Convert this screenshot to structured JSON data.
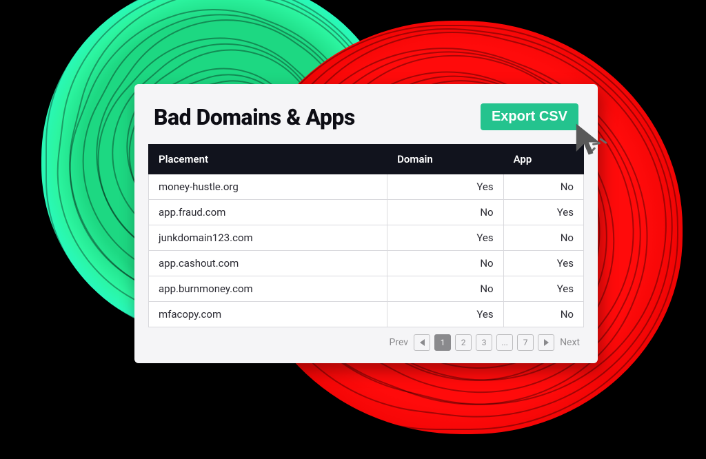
{
  "header": {
    "title": "Bad Domains & Apps",
    "export_label": "Export CSV"
  },
  "table": {
    "columns": [
      "Placement",
      "Domain",
      "App"
    ],
    "rows": [
      {
        "placement": "money-hustle.org",
        "domain": "Yes",
        "app": "No"
      },
      {
        "placement": "app.fraud.com",
        "domain": "No",
        "app": "Yes"
      },
      {
        "placement": "junkdomain123.com",
        "domain": "Yes",
        "app": "No"
      },
      {
        "placement": "app.cashout.com",
        "domain": "No",
        "app": "Yes"
      },
      {
        "placement": "app.burnmoney.com",
        "domain": "No",
        "app": "Yes"
      },
      {
        "placement": "mfacopy.com",
        "domain": "Yes",
        "app": "No"
      }
    ]
  },
  "pager": {
    "prev_label": "Prev",
    "next_label": "Next",
    "pages": [
      "1",
      "2",
      "3",
      "...",
      "7"
    ],
    "current_index": 0
  },
  "colors": {
    "accent_green": "#24c38e",
    "header_dark": "#11131d",
    "blob_green": "#1dd882",
    "blob_red": "#ff0b0b"
  }
}
